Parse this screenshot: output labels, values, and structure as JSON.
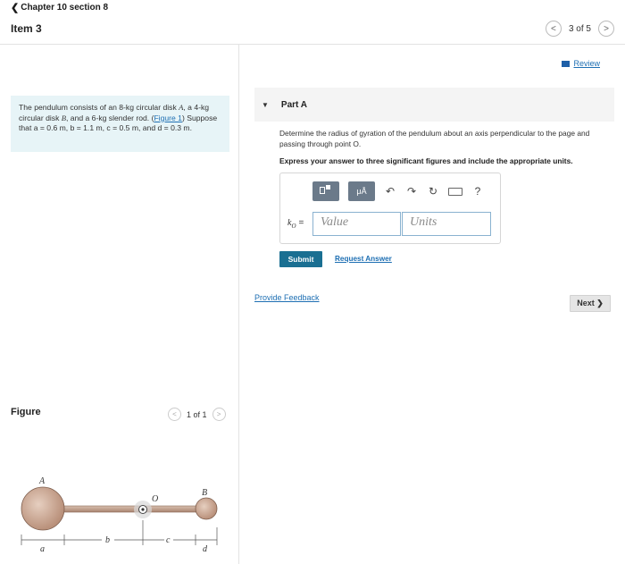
{
  "nav": {
    "back_label": "Chapter 10 section 8"
  },
  "item": {
    "title": "Item 3"
  },
  "pager": {
    "text": "3 of 5",
    "prev": "<",
    "next": ">"
  },
  "review": {
    "label": "Review"
  },
  "problem": {
    "intro": "The pendulum consists of an 8-",
    "kg1": "kg",
    "text1": " circular disk ",
    "A": "A",
    "text2": ", a 4-",
    "kg2": "kg",
    "text3": " circular disk ",
    "B": "B",
    "text4": ", and a 6-",
    "kg3": "kg",
    "text5": " slender rod. (",
    "figure_link": "Figure 1",
    "text6": ") Suppose that ",
    "vars": "a = 0.6 m, b = 1.1 m, c = 0.5 m,",
    "text7": " and ",
    "d": "d = 0.3 m."
  },
  "partA": {
    "title": "Part A",
    "question": "Determine the radius of gyration of the pendulum about an axis perpendicular to the page and passing through point O.",
    "instruction": "Express your answer to three significant figures and include the appropriate units."
  },
  "toolbar": {
    "mu_label": "μÅ",
    "undo": "↶",
    "redo": "↷",
    "reset": "↻",
    "keyboard": "⌨",
    "help": "?"
  },
  "answer": {
    "label": "k",
    "label_sub": "O",
    "equals": "=",
    "value_placeholder": "Value",
    "units_placeholder": "Units"
  },
  "buttons": {
    "submit": "Submit",
    "request_answer": "Request Answer",
    "provide_feedback": "Provide Feedback",
    "next": "Next ❯"
  },
  "figure": {
    "label": "Figure",
    "pager": "1 of 1",
    "labels": {
      "A": "A",
      "B": "B",
      "O": "O",
      "a": "a",
      "b": "b",
      "c": "c",
      "d": "d"
    }
  }
}
